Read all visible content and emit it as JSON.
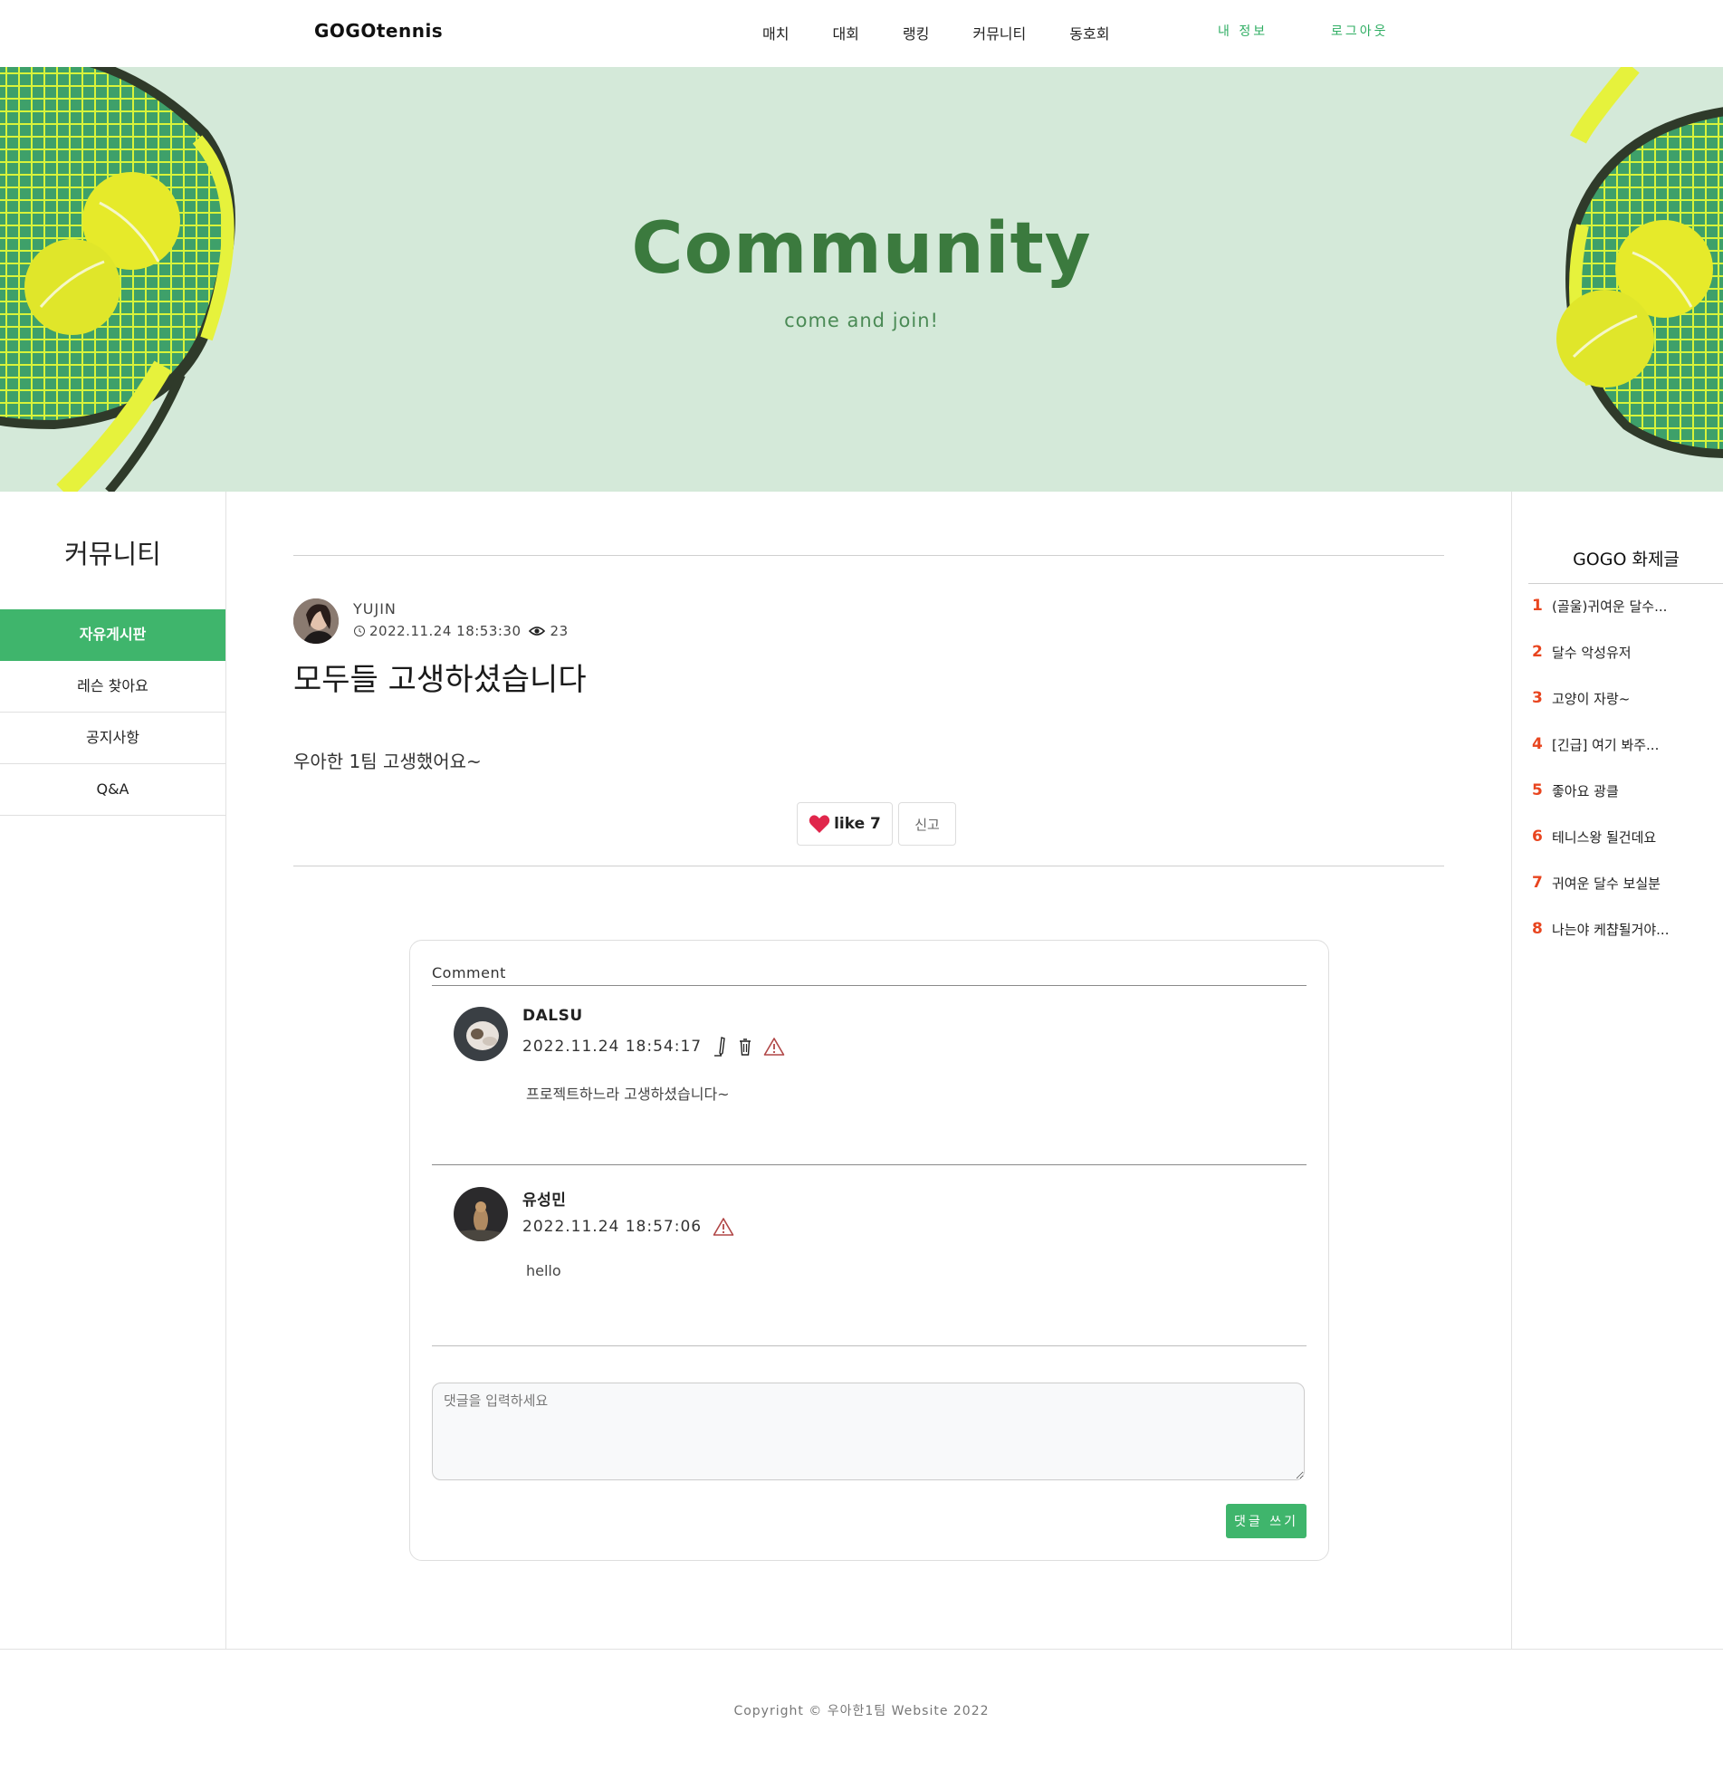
{
  "nav": {
    "brand": "GOGOtennis",
    "links": [
      "매치",
      "대회",
      "랭킹",
      "커뮤니티",
      "동호회"
    ],
    "my_info": "내 정보",
    "logout": "로그아웃"
  },
  "hero": {
    "title": "Community",
    "subtitle": "come and join!"
  },
  "sidebar": {
    "title": "커뮤니티",
    "items": [
      {
        "label": "자유게시판",
        "active": true
      },
      {
        "label": "레슨 찾아요",
        "active": false
      },
      {
        "label": "공지사항",
        "active": false
      },
      {
        "label": "Q&A",
        "active": false
      }
    ]
  },
  "post": {
    "author": "YUJIN",
    "datetime": "2022.11.24 18:53:30",
    "views": "23",
    "title": "모두들 고생하셨습니다",
    "body": "우아한 1팀 고생했어요~",
    "like_label": "like 7",
    "report_label": "신고"
  },
  "comments": {
    "label": "Comment",
    "items": [
      {
        "name": "DALSU",
        "datetime": "2022.11.24 18:54:17",
        "text": "프로젝트하느라 고생하셨습니다~",
        "can_edit": true
      },
      {
        "name": "유성민",
        "datetime": "2022.11.24 18:57:06",
        "text": "hello",
        "can_edit": false
      }
    ],
    "input_placeholder": "댓글을 입력하세요",
    "submit_label": "댓글 쓰기"
  },
  "hot_posts": {
    "title": "GOGO 화제글",
    "items": [
      {
        "rank": "1",
        "title": "(골울)귀여운 달수..."
      },
      {
        "rank": "2",
        "title": "달수 악성유저"
      },
      {
        "rank": "3",
        "title": "고양이 자랑~"
      },
      {
        "rank": "4",
        "title": "[긴급] 여기 봐주..."
      },
      {
        "rank": "5",
        "title": "좋아요 광클"
      },
      {
        "rank": "6",
        "title": "테니스왕 될건데요"
      },
      {
        "rank": "7",
        "title": "귀여운 달수 보실분"
      },
      {
        "rank": "8",
        "title": "나는야 케챱될거야..."
      }
    ]
  },
  "footer": {
    "copyright": "Copyright © 우아한1팀 Website 2022"
  },
  "colors": {
    "accent": "#3fb56c",
    "hero_bg": "#d4e9d9",
    "hero_title": "#3b7a3e",
    "rank": "#e8451f"
  }
}
